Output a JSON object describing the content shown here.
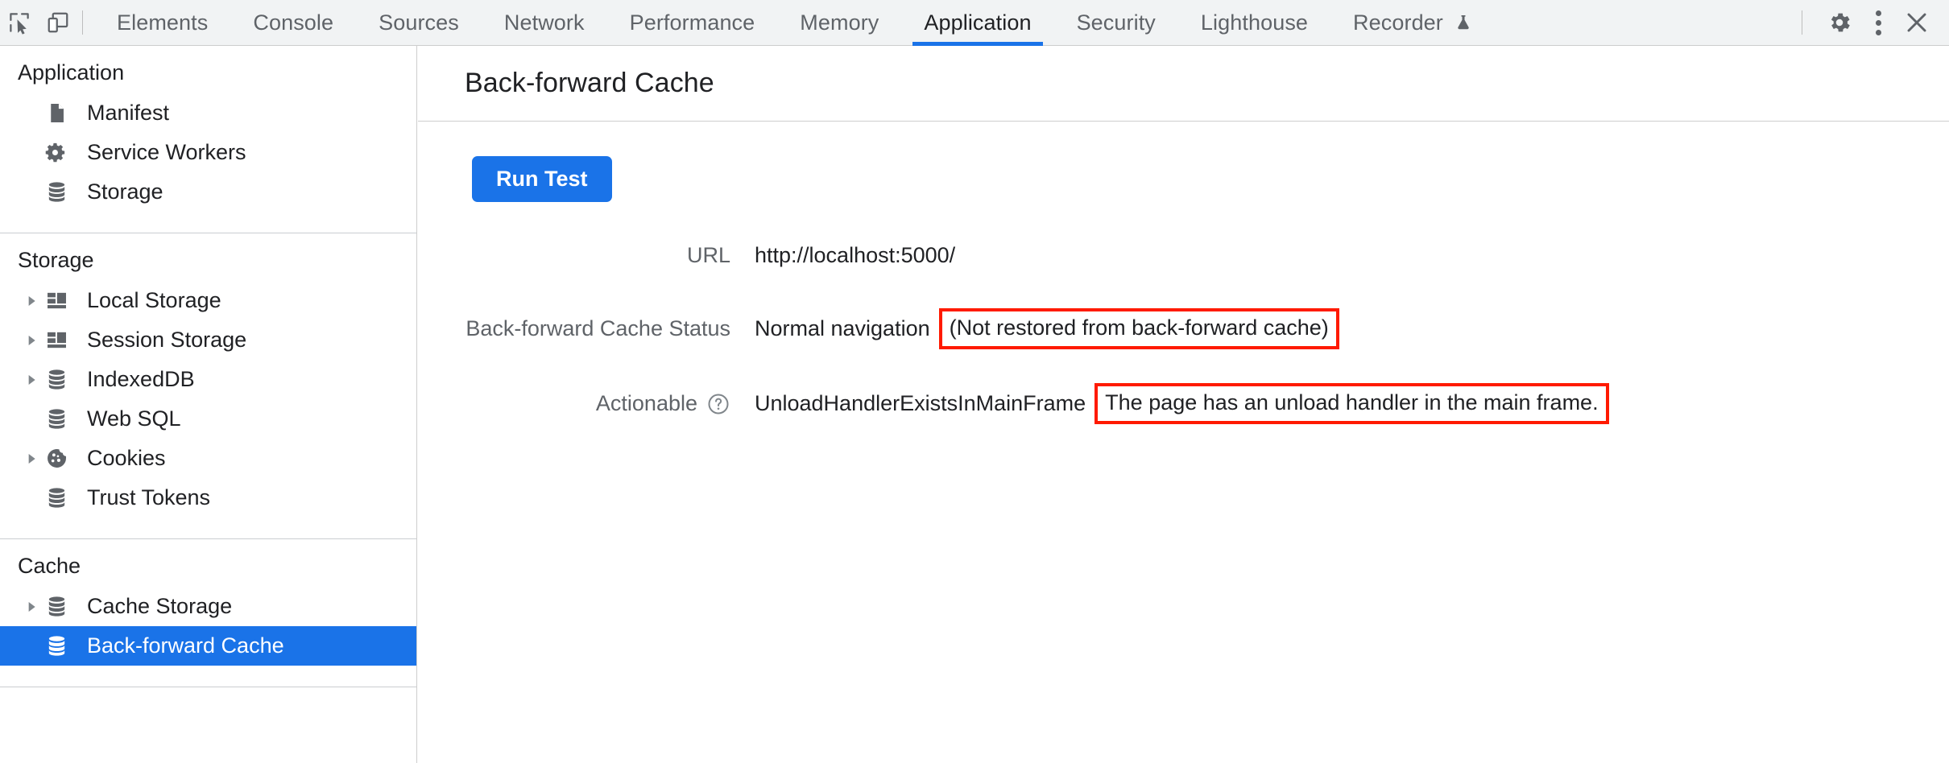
{
  "toolbar": {
    "inspect_icon": "inspect-element-icon",
    "device_icon": "device-toolbar-icon",
    "tabs": [
      {
        "label": "Elements",
        "active": false
      },
      {
        "label": "Console",
        "active": false
      },
      {
        "label": "Sources",
        "active": false
      },
      {
        "label": "Network",
        "active": false
      },
      {
        "label": "Performance",
        "active": false
      },
      {
        "label": "Memory",
        "active": false
      },
      {
        "label": "Application",
        "active": true
      },
      {
        "label": "Security",
        "active": false
      },
      {
        "label": "Lighthouse",
        "active": false
      },
      {
        "label": "Recorder",
        "active": false,
        "icon": "experiment-flask-icon"
      }
    ],
    "settings_icon": "gear-icon",
    "more_icon": "kebab-menu-icon",
    "close_icon": "close-icon",
    "accent": "#1a73e8"
  },
  "sidebar": {
    "sections": [
      {
        "header": "Application",
        "items": [
          {
            "label": "Manifest",
            "icon": "document-icon",
            "arrow": false,
            "selected": false
          },
          {
            "label": "Service Workers",
            "icon": "gear-icon",
            "arrow": false,
            "selected": false
          },
          {
            "label": "Storage",
            "icon": "database-icon",
            "arrow": false,
            "selected": false
          }
        ]
      },
      {
        "header": "Storage",
        "items": [
          {
            "label": "Local Storage",
            "icon": "table-icon",
            "arrow": true,
            "selected": false
          },
          {
            "label": "Session Storage",
            "icon": "table-icon",
            "arrow": true,
            "selected": false
          },
          {
            "label": "IndexedDB",
            "icon": "database-icon",
            "arrow": true,
            "selected": false
          },
          {
            "label": "Web SQL",
            "icon": "database-icon",
            "arrow": false,
            "selected": false
          },
          {
            "label": "Cookies",
            "icon": "cookie-icon",
            "arrow": true,
            "selected": false
          },
          {
            "label": "Trust Tokens",
            "icon": "database-icon",
            "arrow": false,
            "selected": false
          }
        ]
      },
      {
        "header": "Cache",
        "items": [
          {
            "label": "Cache Storage",
            "icon": "database-icon",
            "arrow": true,
            "selected": false
          },
          {
            "label": "Back-forward Cache",
            "icon": "database-icon",
            "arrow": false,
            "selected": true
          }
        ]
      }
    ],
    "selected_bg": "#1a73e8"
  },
  "main": {
    "title": "Back-forward Cache",
    "run_test_label": "Run Test",
    "report": {
      "url_label": "URL",
      "url_value": "http://localhost:5000/",
      "status_label": "Back-forward Cache Status",
      "status_value": "Normal navigation",
      "status_detail": "(Not restored from back-forward cache)",
      "actionable_label": "Actionable",
      "actionable_help_icon": "help-circle-icon",
      "actionable_value": "UnloadHandlerExistsInMainFrame",
      "actionable_detail": "The page has an unload handler in the main frame."
    },
    "annotation_color": "#ff1a00"
  }
}
